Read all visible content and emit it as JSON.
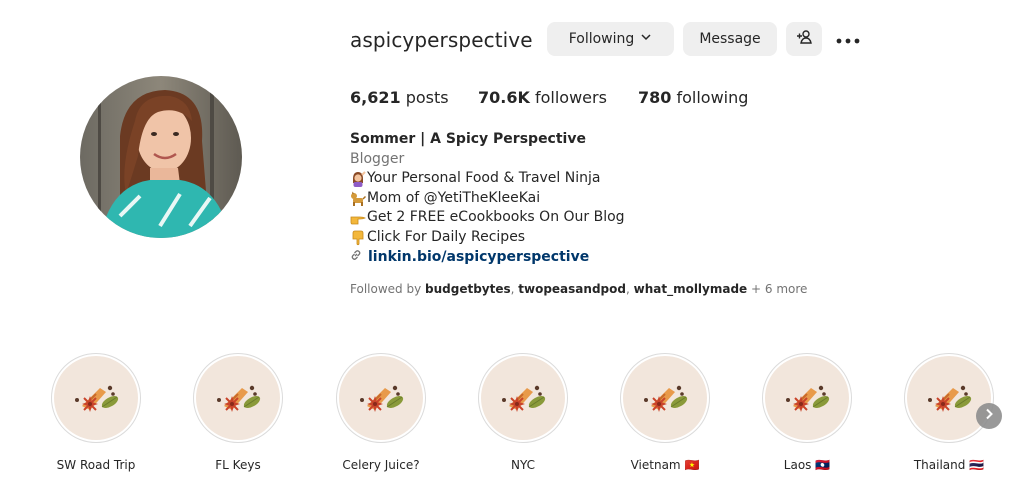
{
  "profile": {
    "username": "aspicyperspective",
    "buttons": {
      "following": "Following",
      "message": "Message",
      "add_user_icon": "add-user-icon",
      "more_icon": "more-options-icon"
    },
    "stats": {
      "posts_count": "6,621",
      "posts_label": " posts",
      "followers_count": "70.6K",
      "followers_label": " followers",
      "following_count": "780",
      "following_label": " following"
    },
    "bio": {
      "name": "Sommer | A Spicy Perspective",
      "category": "Blogger",
      "lines": [
        {
          "icon": "woman-icon",
          "text": "Your Personal Food & Travel Ninja"
        },
        {
          "icon": "dog-icon",
          "text": "Mom of @YetiTheKleeKai"
        },
        {
          "icon": "pointing-right-icon",
          "text": "Get 2 FREE eCookbooks On Our Blog"
        },
        {
          "icon": "pointing-down-icon",
          "text": "Click For Daily Recipes"
        }
      ],
      "link": "linkin.bio/aspicyperspective"
    },
    "followed_by": {
      "prefix": "Followed by ",
      "users": [
        "budgetbytes",
        "twopeasandpod",
        "what_mollymade"
      ],
      "suffix": " + 6 more"
    }
  },
  "highlights": [
    {
      "label": "SW Road Trip"
    },
    {
      "label": "FL Keys"
    },
    {
      "label": "Celery Juice?"
    },
    {
      "label": "NYC"
    },
    {
      "label": "Vietnam 🇻🇳"
    },
    {
      "label": "Laos 🇱🇦"
    },
    {
      "label": "Thailand 🇹🇭"
    }
  ],
  "colors": {
    "button_bg": "#efefef",
    "link": "#00376b",
    "muted": "#737373",
    "highlight_bg": "#f2e6dc"
  }
}
